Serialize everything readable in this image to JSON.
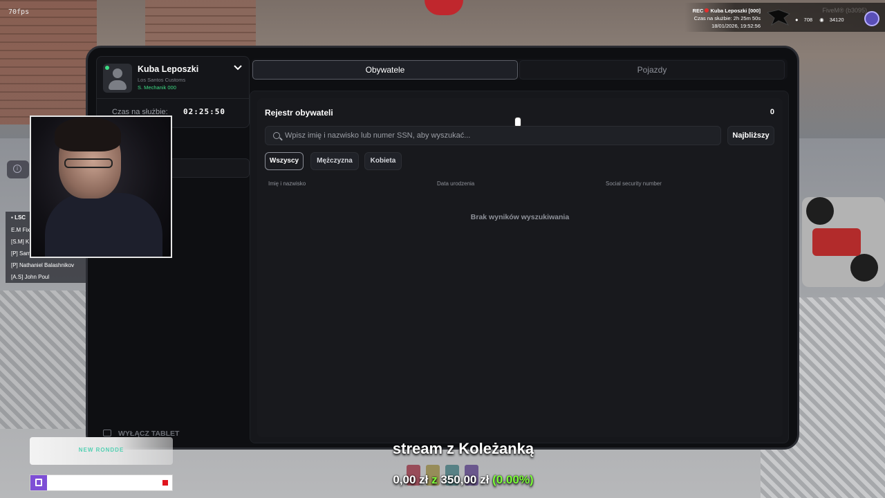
{
  "overlay": {
    "fps": "70fps",
    "hud": {
      "rec_label": "REC",
      "player": "Kuba Leposzki [000]",
      "duty_line": "Czas na służbie: 2h 25m 50s",
      "datetime": "18/01/2026, 19:52:56",
      "players": "708",
      "coins": "34120",
      "server": "FiveM® (b3095)"
    },
    "lsc": {
      "title": "LSC",
      "items": [
        "E.M Fix",
        "[S.M] K",
        "[P] Samir Sultan",
        "[P] Nathaniel Balashnikov",
        "[A.S] John Poul"
      ]
    },
    "stream": {
      "sub_text": "NEW RONDDE",
      "goal_title": "stream z Koleżanką",
      "goal_current": "0,00 zł",
      "goal_sep": "z",
      "goal_target": "350,00 zł",
      "goal_percent": "(0.00%)",
      "goal_progress": 0
    }
  },
  "tablet": {
    "profile": {
      "name": "Kuba Leposzki",
      "org": "Los Santos Customs",
      "rank": "S. Mechanik   000",
      "duty_label": "Czas na służbie:",
      "duty_time": "02:25:50"
    },
    "logout_label": "WYŁĄCZ TABLET",
    "tabs": [
      "Obywatele",
      "Pojazdy"
    ],
    "register": {
      "title": "Rejestr obywateli",
      "count": "0",
      "search_placeholder": "Wpisz imię i nazwisko lub numer SSN, aby wyszukać...",
      "nearest_label": "Najbliższy",
      "filters": [
        "Wszyscy",
        "Mężczyzna",
        "Kobieta"
      ],
      "columns": [
        "Imię i nazwisko",
        "Data urodzenia",
        "Social security number"
      ],
      "empty_text": "Brak wyników wyszukiwania"
    }
  },
  "colors": {
    "accent_green": "#3ddc84",
    "goal_green": "#7dff3a",
    "twitch": "#7e4fd6"
  }
}
